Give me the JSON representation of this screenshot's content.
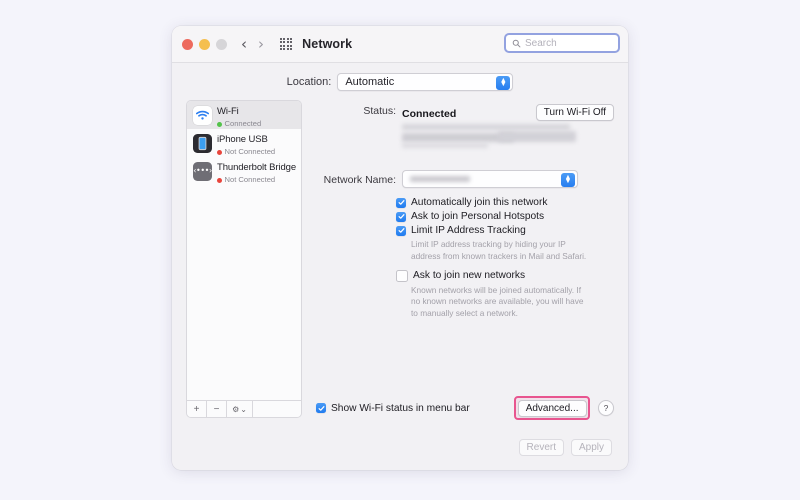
{
  "window": {
    "title": "Network",
    "traffic_lights": [
      "close",
      "minimize",
      "zoom"
    ],
    "back_icon": "chevron-left-icon",
    "forward_icon": "chevron-right-icon",
    "grid_icon": "grid-apps-icon"
  },
  "search": {
    "placeholder": "Search",
    "icon": "search-icon",
    "focus_ring_color": "#93a2e0"
  },
  "location": {
    "label": "Location:",
    "value": "Automatic",
    "options": [
      "Automatic"
    ]
  },
  "sidebar": {
    "items": [
      {
        "name": "Wi-Fi",
        "status": "Connected",
        "state": "connected",
        "icon": "wifi-icon",
        "selected": true
      },
      {
        "name": "iPhone USB",
        "status": "Not Connected",
        "state": "disconnected",
        "icon": "iphone-icon",
        "selected": false
      },
      {
        "name": "Thunderbolt Bridge",
        "status": "Not Connected",
        "state": "disconnected",
        "icon": "thunderbolt-icon",
        "selected": false
      }
    ],
    "toolbar": {
      "add_label": "+",
      "remove_label": "−",
      "actions_label": "⚙",
      "actions_chevron": "⌄"
    }
  },
  "main": {
    "status_label": "Status:",
    "status_value": "Connected",
    "turn_off_button": "Turn Wi-Fi Off",
    "status_detail_redacted": true,
    "network_name_label": "Network Name:",
    "network_name_value_redacted": true,
    "checkboxes": [
      {
        "label": "Automatically join this network",
        "checked": true
      },
      {
        "label": "Ask to join Personal Hotspots",
        "checked": true
      },
      {
        "label": "Limit IP Address Tracking",
        "checked": true
      },
      {
        "label": "Ask to join new networks",
        "checked": false
      }
    ],
    "help_texts": [
      "Limit IP address tracking by hiding your IP address from known trackers in Mail and Safari.",
      "Known networks will be joined automatically. If no known networks are available, you will have to manually select a network."
    ],
    "show_status_checkbox": {
      "label": "Show Wi-Fi status in menu bar",
      "checked": true
    },
    "advanced_button": "Advanced...",
    "advanced_highlight_color": "#e8558f",
    "help_button": "?"
  },
  "footer": {
    "revert_label": "Revert",
    "apply_label": "Apply",
    "revert_enabled": false,
    "apply_enabled": false
  },
  "colors": {
    "page_background": "#f4f4fb",
    "window_background": "#f2f1f4",
    "accent_blue": "#2b7ef0",
    "connected_green": "#53c24a",
    "disconnected_red": "#e8453c"
  }
}
